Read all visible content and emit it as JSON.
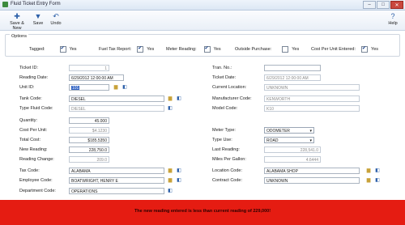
{
  "window": {
    "title": "Fluid Ticket Entry Form",
    "minimize": "–",
    "maximize": "□",
    "close": "✕"
  },
  "toolbar": {
    "save_new": "Save & New",
    "save": "Save",
    "undo": "Undo",
    "help": "Help",
    "icons": {
      "save_new": "✚",
      "save": "▼",
      "undo": "↶",
      "help": "?"
    }
  },
  "options": {
    "group_label": "Options",
    "tagged": {
      "label": "Tagged:",
      "value_label": "Yes",
      "checked": true
    },
    "fuel_tax": {
      "label": "Fuel Tax Report:",
      "value_label": "Yes",
      "checked": true
    },
    "meter_reading": {
      "label": "Meter Reading:",
      "value_label": "Yes",
      "checked": true
    },
    "outside_purchase": {
      "label": "Outside Purchase:",
      "value_label": "Yes",
      "checked": false
    },
    "cost_per_unit": {
      "label": "Cost Per Unit Entered:",
      "value_label": "Yes",
      "checked": true
    }
  },
  "left": {
    "ticket_id": {
      "label": "Ticket ID:",
      "value": "1"
    },
    "reading_date": {
      "label": "Reading Date:",
      "value": "6/29/2012 12:00:00 AM"
    },
    "unit_id": {
      "label": "Unit ID:",
      "value": "101"
    },
    "tank_code": {
      "label": "Tank Code:",
      "value": "DIESEL"
    },
    "type_fluid_code": {
      "label": "Type Fluid Code:",
      "value": "DIESEL"
    },
    "quantity": {
      "label": "Quantity:",
      "value": "45.000"
    },
    "cost_per_unit": {
      "label": "Cost Per Unit:",
      "value": "$4.1230"
    },
    "total_cost": {
      "label": "Total Cost:",
      "value": "$185.5350"
    },
    "new_reading": {
      "label": "New Reading:",
      "value": "228,750.0"
    },
    "reading_change": {
      "label": "Reading Change:",
      "value": "209.0"
    },
    "tax_code": {
      "label": "Tax Code:",
      "value": "ALABAMA"
    },
    "employee_code": {
      "label": "Employee Code:",
      "value": "BOATWRIGHT, HENRY E"
    },
    "department_code": {
      "label": "Department Code:",
      "value": "OPERATIONS"
    }
  },
  "right": {
    "tran_no": {
      "label": "Tran. No.:",
      "value": ""
    },
    "ticket_date": {
      "label": "Ticket Date:",
      "value": "6/29/2012 12:00:00 AM"
    },
    "current_location": {
      "label": "Current Location:",
      "value": "UNKNOWN"
    },
    "manufacturer_code": {
      "label": "Manufacturer Code:",
      "value": "KENWORTH"
    },
    "model_code": {
      "label": "Model Code:",
      "value": "K10"
    },
    "meter_type": {
      "label": "Meter Type:",
      "value": "ODOMETER"
    },
    "type_use": {
      "label": "Type Use:",
      "value": "ROAD"
    },
    "last_reading": {
      "label": "Last Reading:",
      "value": "228,541.0"
    },
    "miles_per_gallon": {
      "label": "Miles Per Gallon:",
      "value": "4.6444"
    },
    "location_code": {
      "label": "Location Code:",
      "value": "ALABAMA SHOP"
    },
    "contract_code": {
      "label": "Contract Code:",
      "value": "UNKNOWN"
    }
  },
  "error": {
    "message": "The new reading entered is less than current reading of 229,000!"
  },
  "colors": {
    "error_bg": "#e51c12",
    "selection": "#2f62c4"
  }
}
